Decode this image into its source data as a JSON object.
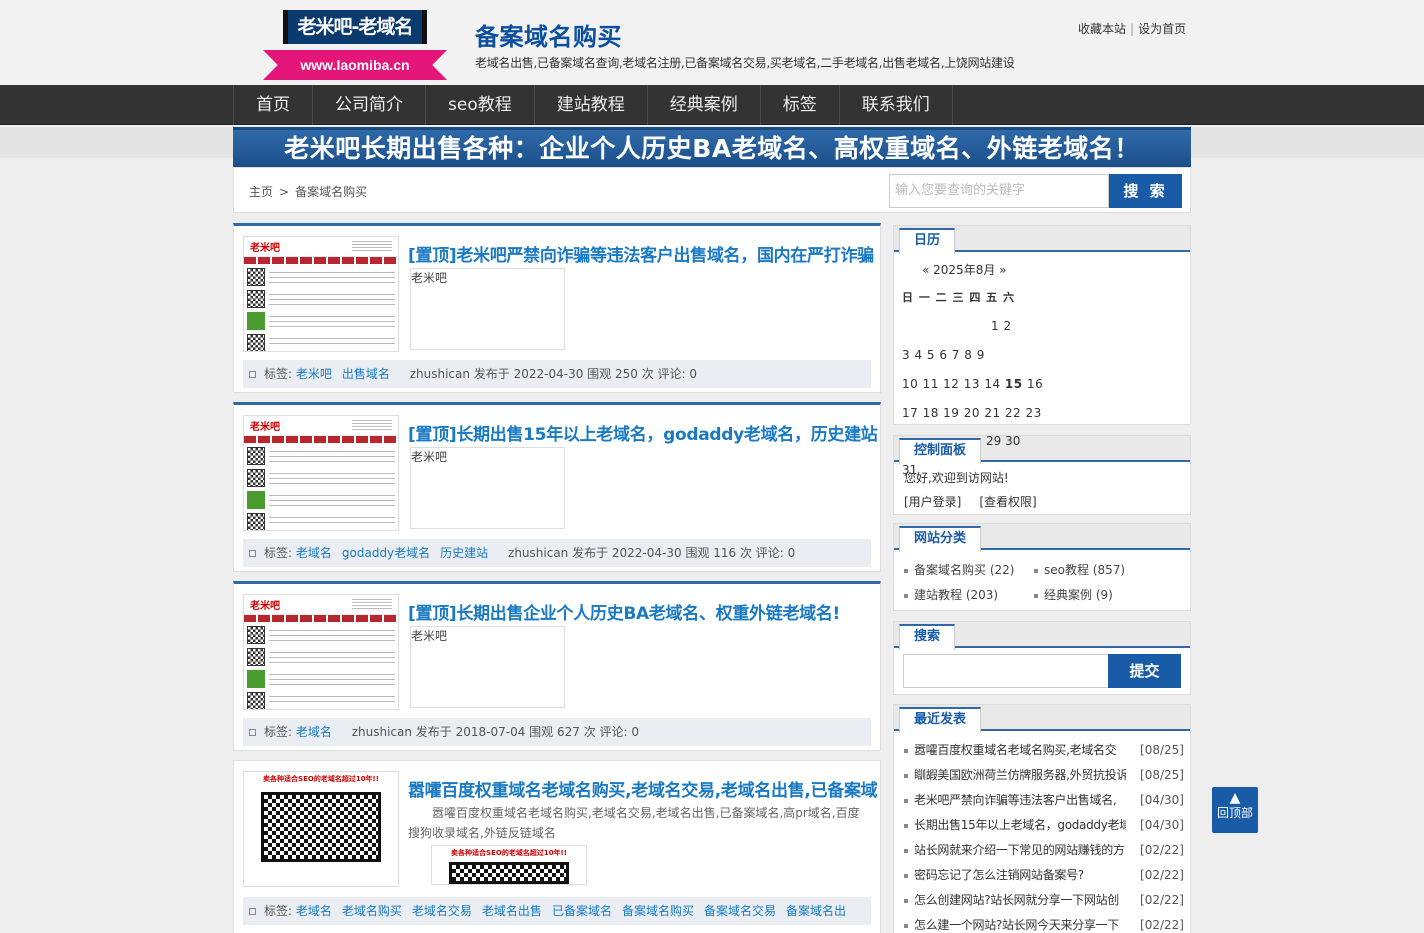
{
  "header": {
    "logo_top": "老米吧-老域名",
    "logo_url": "www.laomiba.cn",
    "site_title": "备案域名购买",
    "site_desc": "老域名出售,已备案域名查询,老域名注册,已备案域名交易,买老域名,二手老域名,出售老域名,上饶网站建设",
    "fav_link": "收藏本站",
    "sep": "|",
    "home_link": "设为首页"
  },
  "nav": {
    "items": [
      "首页",
      "公司简介",
      "seo教程",
      "建站教程",
      "经典案例",
      "标签",
      "联系我们"
    ]
  },
  "banner": "老米吧长期出售各种：企业个人历史BA老域名、高权重域名、外链老域名！",
  "breadcrumb": {
    "home": "主页",
    "gt": ">",
    "current": "备案域名购买"
  },
  "search_top": {
    "placeholder": "输入您要查询的关键字",
    "button": "搜 索"
  },
  "posts": [
    {
      "title": "[置顶]老米吧严禁向诈骗等违法客户出售域名，国内在严打诈骗",
      "tags_label": "标签:",
      "tags": [
        "老米吧",
        "出售域名"
      ],
      "meta": "zhushican 发布于 2022-04-30 围观 250 次 评论: 0"
    },
    {
      "title": "[置顶]长期出售15年以上老域名，godaddy老域名，历史建站",
      "tags_label": "标签:",
      "tags": [
        "老域名",
        "godaddy老域名",
        "历史建站"
      ],
      "meta": "zhushican 发布于 2022-04-30 围观 116 次 评论: 0"
    },
    {
      "title": "[置顶]长期出售企业个人历史BA老域名、权重外链老域名!",
      "tags_label": "标签:",
      "tags": [
        "老域名"
      ],
      "meta": "zhushican 发布于 2018-07-04 围观 627 次 评论: 0"
    },
    {
      "title": "嚣嚯百度权重域名老域名购买,老域名交易,老域名出售,已备案域",
      "excerpt": "嚣嚯百度权重域名老域名购买,老域名交易,老域名出售,已备案域名,高pr域名,百度搜狗收录域名,外链反链域名",
      "tags_label": "标签:",
      "tags": [
        "老域名",
        "老域名购买",
        "老域名交易",
        "老域名出售",
        "已备案域名",
        "备案域名购买",
        "备案域名交易",
        "备案域名出"
      ]
    }
  ],
  "thumb": {
    "logo": "老米吧",
    "qr_head": "卖各种适合SEO的老域名超过10年!!"
  },
  "calendar": {
    "tab": "日历",
    "month": "« 2025年8月 »",
    "weekdays": "日  一  二  三  四  五  六",
    "rows": [
      "                        1   2",
      "3   4   5   6   7   8   9",
      "10  11  12  13  14  15  16",
      "17  18  19  20  21  22  23",
      "24  25  26  27  28  29  30",
      "31"
    ],
    "r1": "1  2",
    "r2": "3  4  5  6  7  8  9",
    "r3a": "10 11 12 13 14 ",
    "r3b": "15",
    "r3c": " 16",
    "r4": "17 18 19 20 21 22 23",
    "r5": "29 30",
    "r6": "31"
  },
  "control": {
    "tab": "控制面板",
    "welcome": "您好,欢迎到访网站!",
    "login": "[用户登录]",
    "perm": "[查看权限]"
  },
  "categories": {
    "tab": "网站分类",
    "items": [
      "备案域名购买 (22)",
      "seo教程 (857)",
      "建站教程 (203)",
      "经典案例 (9)"
    ]
  },
  "side_search": {
    "tab": "搜索",
    "button": "提交"
  },
  "recent": {
    "tab": "最近发表",
    "items": [
      {
        "title": "嚣嚯百度权重域名老域名购买,老域名交",
        "date": "[08/25]"
      },
      {
        "title": "瞓嘏美国欧洲荷兰仿牌服务器,外贸抗投诉",
        "date": "[08/25]"
      },
      {
        "title": "老米吧严禁向诈骗等违法客户出售域名,",
        "date": "[04/30]"
      },
      {
        "title": "长期出售15年以上老域名，godaddy老域",
        "date": "[04/30]"
      },
      {
        "title": "站长网就来介绍一下常见的网站赚钱的方",
        "date": "[02/22]"
      },
      {
        "title": "密码忘记了怎么注销网站备案号?",
        "date": "[02/22]"
      },
      {
        "title": "怎么创建网站?站长网就分享一下网站创",
        "date": "[02/22]"
      },
      {
        "title": "怎么建一个网站?站长网今天来分享一下",
        "date": "[02/22]"
      }
    ]
  },
  "backtop": {
    "arrow": "▲",
    "label": "回顶部"
  }
}
